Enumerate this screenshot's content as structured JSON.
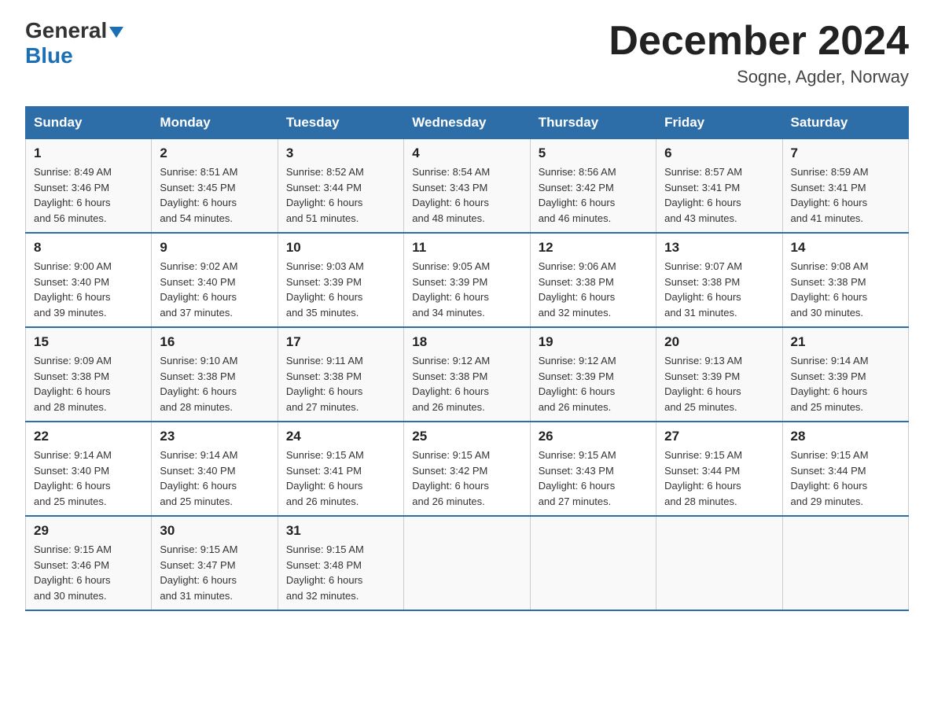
{
  "header": {
    "logo_line1": "General",
    "logo_line2": "Blue",
    "month_title": "December 2024",
    "location": "Sogne, Agder, Norway"
  },
  "days_of_week": [
    "Sunday",
    "Monday",
    "Tuesday",
    "Wednesday",
    "Thursday",
    "Friday",
    "Saturday"
  ],
  "weeks": [
    [
      {
        "day": "1",
        "sunrise": "8:49 AM",
        "sunset": "3:46 PM",
        "daylight": "6 hours and 56 minutes."
      },
      {
        "day": "2",
        "sunrise": "8:51 AM",
        "sunset": "3:45 PM",
        "daylight": "6 hours and 54 minutes."
      },
      {
        "day": "3",
        "sunrise": "8:52 AM",
        "sunset": "3:44 PM",
        "daylight": "6 hours and 51 minutes."
      },
      {
        "day": "4",
        "sunrise": "8:54 AM",
        "sunset": "3:43 PM",
        "daylight": "6 hours and 48 minutes."
      },
      {
        "day": "5",
        "sunrise": "8:56 AM",
        "sunset": "3:42 PM",
        "daylight": "6 hours and 46 minutes."
      },
      {
        "day": "6",
        "sunrise": "8:57 AM",
        "sunset": "3:41 PM",
        "daylight": "6 hours and 43 minutes."
      },
      {
        "day": "7",
        "sunrise": "8:59 AM",
        "sunset": "3:41 PM",
        "daylight": "6 hours and 41 minutes."
      }
    ],
    [
      {
        "day": "8",
        "sunrise": "9:00 AM",
        "sunset": "3:40 PM",
        "daylight": "6 hours and 39 minutes."
      },
      {
        "day": "9",
        "sunrise": "9:02 AM",
        "sunset": "3:40 PM",
        "daylight": "6 hours and 37 minutes."
      },
      {
        "day": "10",
        "sunrise": "9:03 AM",
        "sunset": "3:39 PM",
        "daylight": "6 hours and 35 minutes."
      },
      {
        "day": "11",
        "sunrise": "9:05 AM",
        "sunset": "3:39 PM",
        "daylight": "6 hours and 34 minutes."
      },
      {
        "day": "12",
        "sunrise": "9:06 AM",
        "sunset": "3:38 PM",
        "daylight": "6 hours and 32 minutes."
      },
      {
        "day": "13",
        "sunrise": "9:07 AM",
        "sunset": "3:38 PM",
        "daylight": "6 hours and 31 minutes."
      },
      {
        "day": "14",
        "sunrise": "9:08 AM",
        "sunset": "3:38 PM",
        "daylight": "6 hours and 30 minutes."
      }
    ],
    [
      {
        "day": "15",
        "sunrise": "9:09 AM",
        "sunset": "3:38 PM",
        "daylight": "6 hours and 28 minutes."
      },
      {
        "day": "16",
        "sunrise": "9:10 AM",
        "sunset": "3:38 PM",
        "daylight": "6 hours and 28 minutes."
      },
      {
        "day": "17",
        "sunrise": "9:11 AM",
        "sunset": "3:38 PM",
        "daylight": "6 hours and 27 minutes."
      },
      {
        "day": "18",
        "sunrise": "9:12 AM",
        "sunset": "3:38 PM",
        "daylight": "6 hours and 26 minutes."
      },
      {
        "day": "19",
        "sunrise": "9:12 AM",
        "sunset": "3:39 PM",
        "daylight": "6 hours and 26 minutes."
      },
      {
        "day": "20",
        "sunrise": "9:13 AM",
        "sunset": "3:39 PM",
        "daylight": "6 hours and 25 minutes."
      },
      {
        "day": "21",
        "sunrise": "9:14 AM",
        "sunset": "3:39 PM",
        "daylight": "6 hours and 25 minutes."
      }
    ],
    [
      {
        "day": "22",
        "sunrise": "9:14 AM",
        "sunset": "3:40 PM",
        "daylight": "6 hours and 25 minutes."
      },
      {
        "day": "23",
        "sunrise": "9:14 AM",
        "sunset": "3:40 PM",
        "daylight": "6 hours and 25 minutes."
      },
      {
        "day": "24",
        "sunrise": "9:15 AM",
        "sunset": "3:41 PM",
        "daylight": "6 hours and 26 minutes."
      },
      {
        "day": "25",
        "sunrise": "9:15 AM",
        "sunset": "3:42 PM",
        "daylight": "6 hours and 26 minutes."
      },
      {
        "day": "26",
        "sunrise": "9:15 AM",
        "sunset": "3:43 PM",
        "daylight": "6 hours and 27 minutes."
      },
      {
        "day": "27",
        "sunrise": "9:15 AM",
        "sunset": "3:44 PM",
        "daylight": "6 hours and 28 minutes."
      },
      {
        "day": "28",
        "sunrise": "9:15 AM",
        "sunset": "3:44 PM",
        "daylight": "6 hours and 29 minutes."
      }
    ],
    [
      {
        "day": "29",
        "sunrise": "9:15 AM",
        "sunset": "3:46 PM",
        "daylight": "6 hours and 30 minutes."
      },
      {
        "day": "30",
        "sunrise": "9:15 AM",
        "sunset": "3:47 PM",
        "daylight": "6 hours and 31 minutes."
      },
      {
        "day": "31",
        "sunrise": "9:15 AM",
        "sunset": "3:48 PM",
        "daylight": "6 hours and 32 minutes."
      },
      {
        "day": "",
        "sunrise": "",
        "sunset": "",
        "daylight": ""
      },
      {
        "day": "",
        "sunrise": "",
        "sunset": "",
        "daylight": ""
      },
      {
        "day": "",
        "sunrise": "",
        "sunset": "",
        "daylight": ""
      },
      {
        "day": "",
        "sunrise": "",
        "sunset": "",
        "daylight": ""
      }
    ]
  ],
  "labels": {
    "sunrise": "Sunrise:",
    "sunset": "Sunset:",
    "daylight": "Daylight:"
  }
}
